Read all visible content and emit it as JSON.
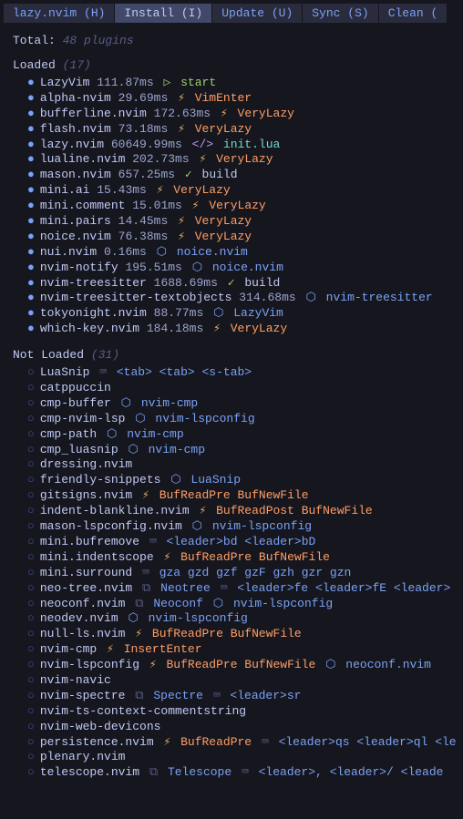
{
  "tabs": [
    {
      "label": "lazy.nvim (H)",
      "active": false
    },
    {
      "label": "Install (I)",
      "active": true
    },
    {
      "label": "Update (U)",
      "active": false
    },
    {
      "label": "Sync (S)",
      "active": false
    },
    {
      "label": "Clean (",
      "active": false
    }
  ],
  "total_label": "Total:",
  "total_count": "48 plugins",
  "loaded_label": "Loaded",
  "loaded_count": "(17)",
  "loaded_plugins": [
    {
      "name": "LazyVim",
      "time": "111.87ms",
      "icon": "play",
      "tag": "start",
      "tag_color": "green"
    },
    {
      "name": "alpha-nvim",
      "time": "29.69ms",
      "icon": "bolt",
      "tag": "VimEnter",
      "tag_color": "orange"
    },
    {
      "name": "bufferline.nvim",
      "time": "172.63ms",
      "icon": "bolt",
      "tag": "VeryLazy",
      "tag_color": "orange"
    },
    {
      "name": "flash.nvim",
      "time": "73.18ms",
      "icon": "bolt",
      "tag": "VeryLazy",
      "tag_color": "orange"
    },
    {
      "name": "lazy.nvim",
      "time": "60649.99ms",
      "icon": "code",
      "tag": "init.lua",
      "tag_color": "teal"
    },
    {
      "name": "lualine.nvim",
      "time": "202.73ms",
      "icon": "bolt",
      "tag": "VeryLazy",
      "tag_color": "orange"
    },
    {
      "name": "mason.nvim",
      "time": "657.25ms",
      "icon": "check",
      "tag": "build",
      "tag_color": "gray"
    },
    {
      "name": "mini.ai",
      "time": "15.43ms",
      "icon": "bolt",
      "tag": "VeryLazy",
      "tag_color": "orange"
    },
    {
      "name": "mini.comment",
      "time": "15.01ms",
      "icon": "bolt",
      "tag": "VeryLazy",
      "tag_color": "orange"
    },
    {
      "name": "mini.pairs",
      "time": "14.45ms",
      "icon": "bolt",
      "tag": "VeryLazy",
      "tag_color": "orange"
    },
    {
      "name": "noice.nvim",
      "time": "76.38ms",
      "icon": "bolt",
      "tag": "VeryLazy",
      "tag_color": "orange"
    },
    {
      "name": "nui.nvim",
      "time": "0.16ms",
      "icon": "box",
      "tag": "noice.nvim",
      "tag_color": "blue"
    },
    {
      "name": "nvim-notify",
      "time": "195.51ms",
      "icon": "box",
      "tag": "noice.nvim",
      "tag_color": "blue"
    },
    {
      "name": "nvim-treesitter",
      "time": "1688.69ms",
      "icon": "check",
      "tag": "build",
      "tag_color": "gray"
    },
    {
      "name": "nvim-treesitter-textobjects",
      "time": "314.68ms",
      "icon": "box",
      "tag": "nvim-treesitter",
      "tag_color": "blue"
    },
    {
      "name": "tokyonight.nvim",
      "time": "88.77ms",
      "icon": "box",
      "tag": "LazyVim",
      "tag_color": "blue"
    },
    {
      "name": "which-key.nvim",
      "time": "184.18ms",
      "icon": "bolt",
      "tag": "VeryLazy",
      "tag_color": "orange"
    }
  ],
  "not_loaded_label": "Not Loaded",
  "not_loaded_count": "(31)",
  "not_loaded_plugins": [
    {
      "name": "LuaSnip",
      "parts": [
        {
          "icon": "key"
        },
        {
          "text": "<tab> <tab> <s-tab>",
          "color": "blue"
        }
      ]
    },
    {
      "name": "catppuccin",
      "parts": []
    },
    {
      "name": "cmp-buffer",
      "parts": [
        {
          "icon": "box"
        },
        {
          "text": "nvim-cmp",
          "color": "blue"
        }
      ]
    },
    {
      "name": "cmp-nvim-lsp",
      "parts": [
        {
          "icon": "box"
        },
        {
          "text": "nvim-lspconfig",
          "color": "blue"
        }
      ]
    },
    {
      "name": "cmp-path",
      "parts": [
        {
          "icon": "box"
        },
        {
          "text": "nvim-cmp",
          "color": "blue"
        }
      ]
    },
    {
      "name": "cmp_luasnip",
      "parts": [
        {
          "icon": "box"
        },
        {
          "text": "nvim-cmp",
          "color": "blue"
        }
      ]
    },
    {
      "name": "dressing.nvim",
      "parts": []
    },
    {
      "name": "friendly-snippets",
      "parts": [
        {
          "icon": "box"
        },
        {
          "text": "LuaSnip",
          "color": "blue"
        }
      ]
    },
    {
      "name": "gitsigns.nvim",
      "parts": [
        {
          "icon": "bolt"
        },
        {
          "text": "BufReadPre BufNewFile",
          "color": "orange"
        }
      ]
    },
    {
      "name": "indent-blankline.nvim",
      "parts": [
        {
          "icon": "bolt"
        },
        {
          "text": "BufReadPost BufNewFile",
          "color": "orange"
        }
      ]
    },
    {
      "name": "mason-lspconfig.nvim",
      "parts": [
        {
          "icon": "box"
        },
        {
          "text": "nvim-lspconfig",
          "color": "blue"
        }
      ]
    },
    {
      "name": "mini.bufremove",
      "parts": [
        {
          "icon": "key"
        },
        {
          "text": "<leader>bd <leader>bD",
          "color": "blue"
        }
      ]
    },
    {
      "name": "mini.indentscope",
      "parts": [
        {
          "icon": "bolt"
        },
        {
          "text": "BufReadPre BufNewFile",
          "color": "orange"
        }
      ]
    },
    {
      "name": "mini.surround",
      "parts": [
        {
          "icon": "key"
        },
        {
          "text": "gza gzd gzf gzF gzh gzr gzn",
          "color": "blue"
        }
      ]
    },
    {
      "name": "neo-tree.nvim",
      "parts": [
        {
          "icon": "cmd"
        },
        {
          "text": "Neotree",
          "color": "blue"
        },
        {
          "icon": "key"
        },
        {
          "text": "<leader>fe <leader>fE <leader>",
          "color": "blue"
        }
      ]
    },
    {
      "name": "neoconf.nvim",
      "parts": [
        {
          "icon": "cmd"
        },
        {
          "text": "Neoconf",
          "color": "blue"
        },
        {
          "icon": "box"
        },
        {
          "text": "nvim-lspconfig",
          "color": "blue"
        }
      ]
    },
    {
      "name": "neodev.nvim",
      "parts": [
        {
          "icon": "box"
        },
        {
          "text": "nvim-lspconfig",
          "color": "blue"
        }
      ]
    },
    {
      "name": "null-ls.nvim",
      "parts": [
        {
          "icon": "bolt"
        },
        {
          "text": "BufReadPre BufNewFile",
          "color": "orange"
        }
      ]
    },
    {
      "name": "nvim-cmp",
      "parts": [
        {
          "icon": "bolt"
        },
        {
          "text": "InsertEnter",
          "color": "orange"
        }
      ]
    },
    {
      "name": "nvim-lspconfig",
      "parts": [
        {
          "icon": "bolt"
        },
        {
          "text": "BufReadPre BufNewFile",
          "color": "orange"
        },
        {
          "icon": "box"
        },
        {
          "text": "neoconf.nvim",
          "color": "blue"
        }
      ]
    },
    {
      "name": "nvim-navic",
      "parts": []
    },
    {
      "name": "nvim-spectre",
      "parts": [
        {
          "icon": "cmd"
        },
        {
          "text": "Spectre",
          "color": "blue"
        },
        {
          "icon": "key"
        },
        {
          "text": "<leader>sr",
          "color": "blue"
        }
      ]
    },
    {
      "name": "nvim-ts-context-commentstring",
      "parts": []
    },
    {
      "name": "nvim-web-devicons",
      "parts": []
    },
    {
      "name": "persistence.nvim",
      "parts": [
        {
          "icon": "bolt"
        },
        {
          "text": "BufReadPre",
          "color": "orange"
        },
        {
          "icon": "key"
        },
        {
          "text": "<leader>qs <leader>ql <le",
          "color": "blue"
        }
      ]
    },
    {
      "name": "plenary.nvim",
      "parts": []
    },
    {
      "name": "telescope.nvim",
      "parts": [
        {
          "icon": "cmd"
        },
        {
          "text": "Telescope",
          "color": "blue"
        },
        {
          "icon": "key"
        },
        {
          "text": "<leader>, <leader>/ <leade",
          "color": "blue"
        }
      ]
    }
  ],
  "icons": {
    "play": "▷",
    "bolt": "⚡",
    "code": "</>",
    "check": "✓",
    "box": "📦",
    "key": "⌨",
    "cmd": ">_"
  }
}
